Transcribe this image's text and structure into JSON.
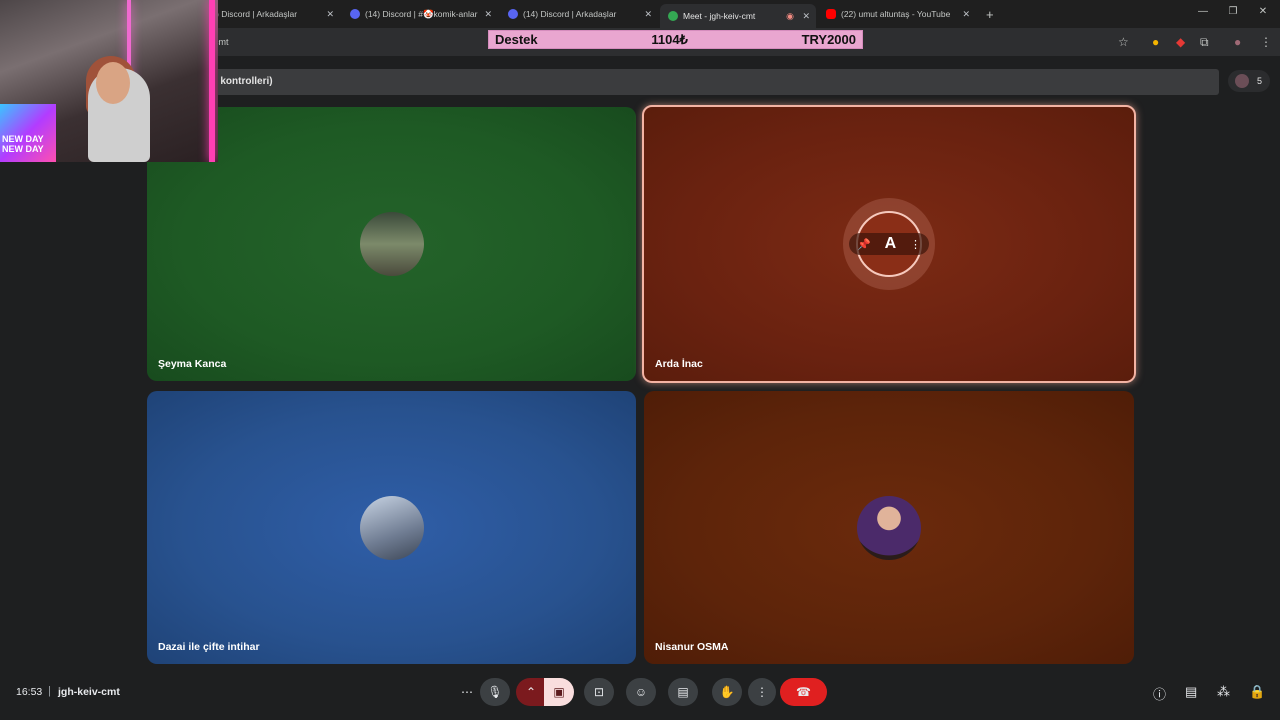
{
  "tabs": [
    {
      "title": ") Discord | Arkadaşlar",
      "fav": "#5865f2"
    },
    {
      "title": "(14) Discord | #🤡komik-anlar",
      "fav": "#5865f2"
    },
    {
      "title": "(14) Discord | Arkadaşlar",
      "fav": "#5865f2"
    },
    {
      "title": "Meet - jgh-keiv-cmt",
      "fav": "#34a853"
    },
    {
      "title": "(22) umut altuntaş - YouTube",
      "fav": "#ff0000"
    }
  ],
  "new_tab": "+",
  "address": {
    "url": "cmt"
  },
  "donation": {
    "label": "Destek",
    "amount": "1104₺",
    "goal": "TRY2000"
  },
  "infobar": {
    "text": "e kontrolleri)"
  },
  "people_count": "5",
  "participants": [
    {
      "name": "Şeyma Kanca",
      "color": "#1e5a24"
    },
    {
      "name": "Arda İnac",
      "color": "#6a2210",
      "speaking": true,
      "initial": "A"
    },
    {
      "name": "Dazai ile çifte intihar",
      "color": "#28528f"
    },
    {
      "name": "Nisanur OSMA",
      "color": "#5d240a"
    }
  ],
  "bottom": {
    "time": "16:53",
    "meeting_code": "jgh-keiv-cmt"
  },
  "webcam": {
    "badge": "NEW DAY NEW DAY"
  }
}
